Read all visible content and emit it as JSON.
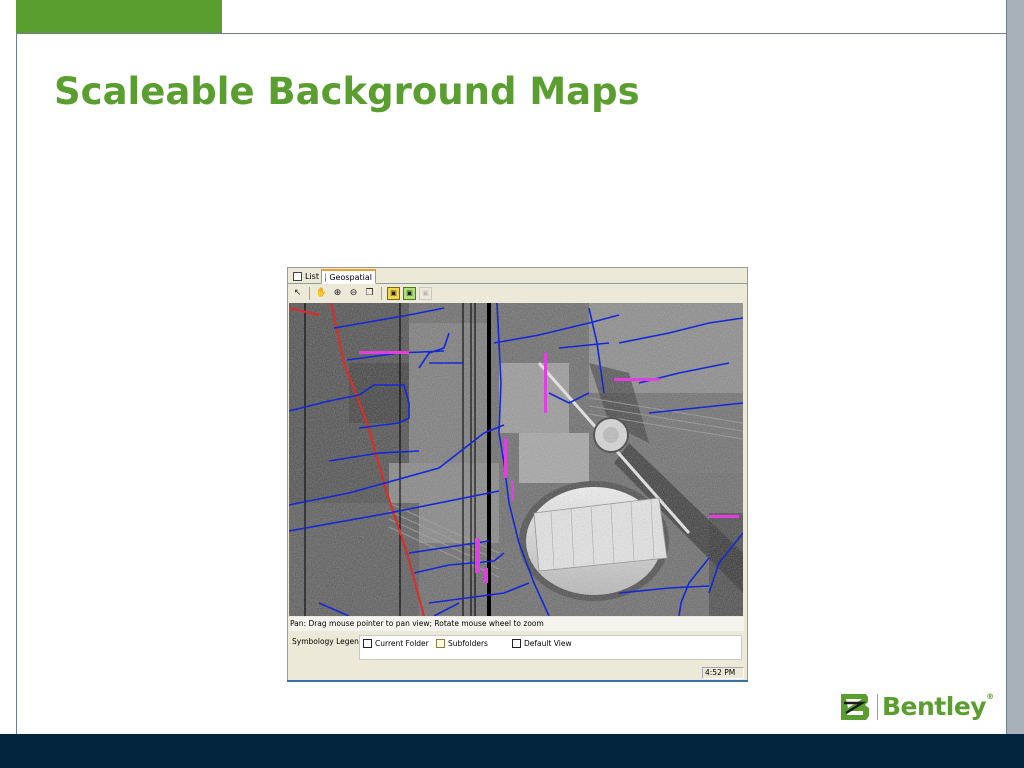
{
  "slide": {
    "title": "Scaleable Background Maps"
  },
  "app": {
    "tabs": [
      {
        "label": "List",
        "icon": "list-icon",
        "active": false
      },
      {
        "label": "Geospatial",
        "icon": "globe-icon",
        "active": true
      }
    ],
    "toolbar": {
      "tools": [
        "select-arrow-icon",
        "pan-hand-icon",
        "zoom-in-icon",
        "zoom-out-icon",
        "zoom-extents-icon",
        "layer-yellow-icon",
        "layer-green-icon",
        "layer-disabled-icon"
      ]
    },
    "map": {
      "description_kind": "aerial-photograph",
      "overlay_colors": {
        "parcel_lines": "#1428d8",
        "rail_line": "#e02a2a",
        "points": "#e040e0"
      }
    },
    "status_text": "Pan: Drag mouse pointer to pan view; Rotate mouse wheel to zoom",
    "legend": {
      "label": "Symbology Legend:",
      "items": [
        {
          "label": "Current Folder",
          "swatch": "#ffffff"
        },
        {
          "label": "Subfolders",
          "swatch": "#fffbe6"
        },
        {
          "label": "Default View",
          "swatch": "#ffffff"
        }
      ]
    },
    "clock": "4:52 PM"
  },
  "logo": {
    "text": "Bentley",
    "mark": "®"
  },
  "colors": {
    "accent_green": "#5a9e2f",
    "navy_bar": "#03253e",
    "gray_bar": "#a8b1b9"
  }
}
